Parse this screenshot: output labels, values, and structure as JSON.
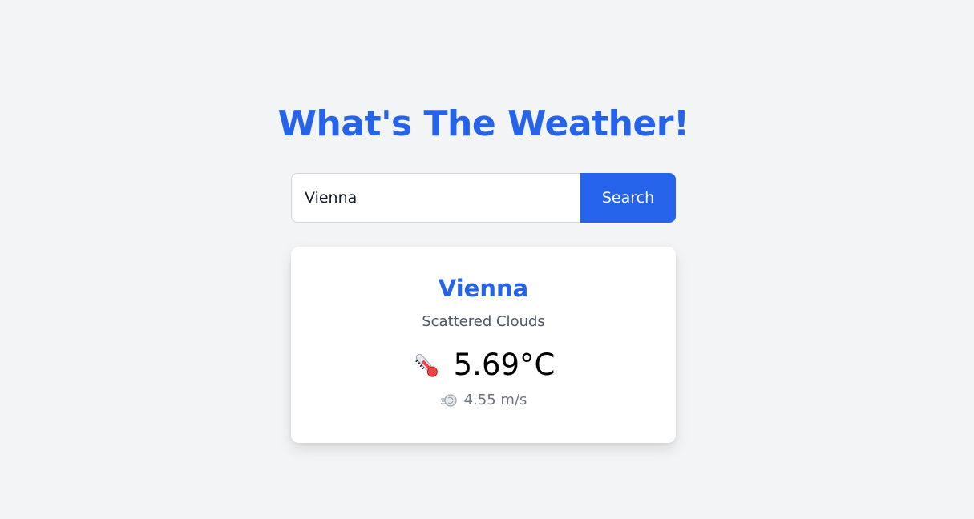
{
  "header": {
    "title": "What's The Weather!"
  },
  "search": {
    "value": "Vienna",
    "button_label": "Search"
  },
  "weather": {
    "city": "Vienna",
    "description": "Scattered Clouds",
    "temperature": "5.69°C",
    "wind": "4.55 m/s",
    "temperature_icon": "thermometer-icon",
    "wind_icon": "wind-icon"
  },
  "colors": {
    "accent": "#2563eb",
    "background": "#f3f4f6",
    "card": "#ffffff",
    "muted_text": "#6b7280"
  }
}
